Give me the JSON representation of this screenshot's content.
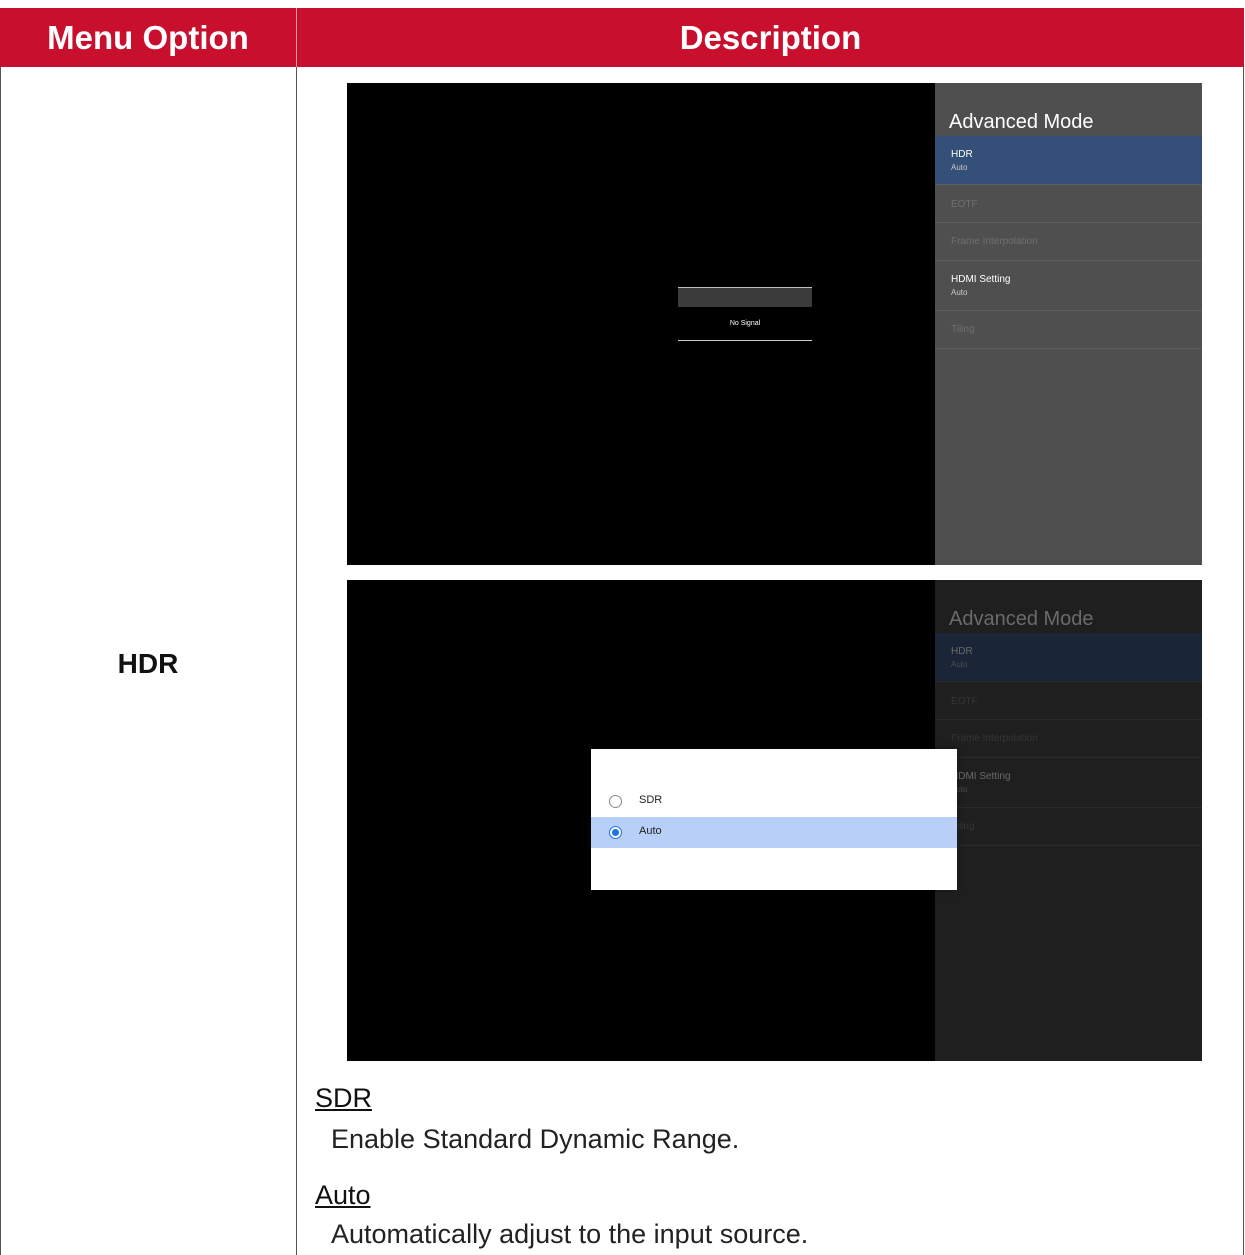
{
  "table": {
    "header": {
      "menu_option": "Menu Option",
      "description": "Description"
    },
    "menu_option": "HDR"
  },
  "screenshot1": {
    "panel_title": "Advanced Mode",
    "items": [
      {
        "label": "HDR",
        "sub": "Auto"
      },
      {
        "label": "EOTF",
        "sub": ""
      },
      {
        "label": "Frame Interpolation",
        "sub": ""
      },
      {
        "label": "HDMI Setting",
        "sub": "Auto"
      },
      {
        "label": "Tiling",
        "sub": ""
      }
    ],
    "no_signal": "No Signal"
  },
  "screenshot2": {
    "panel_title": "Advanced Mode",
    "items": [
      {
        "label": "HDR",
        "sub": "Auto"
      },
      {
        "label": "EOTF",
        "sub": ""
      },
      {
        "label": "Frame Interpolation",
        "sub": ""
      },
      {
        "label": "HDMI Setting",
        "sub": "Auto"
      },
      {
        "label": "Tiling",
        "sub": ""
      }
    ],
    "dialog_options": [
      {
        "label": "SDR",
        "selected": false
      },
      {
        "label": "Auto",
        "selected": true
      }
    ]
  },
  "descriptions": [
    {
      "heading": "SDR",
      "text": "Enable Standard Dynamic Range."
    },
    {
      "heading": "Auto",
      "text": "Automatically adjust to the input source."
    }
  ],
  "colors": {
    "header_red": "#c8102e",
    "menu_selected": "#345079",
    "dialog_selected": "#b8cff7",
    "radio_on": "#1a73e8"
  }
}
